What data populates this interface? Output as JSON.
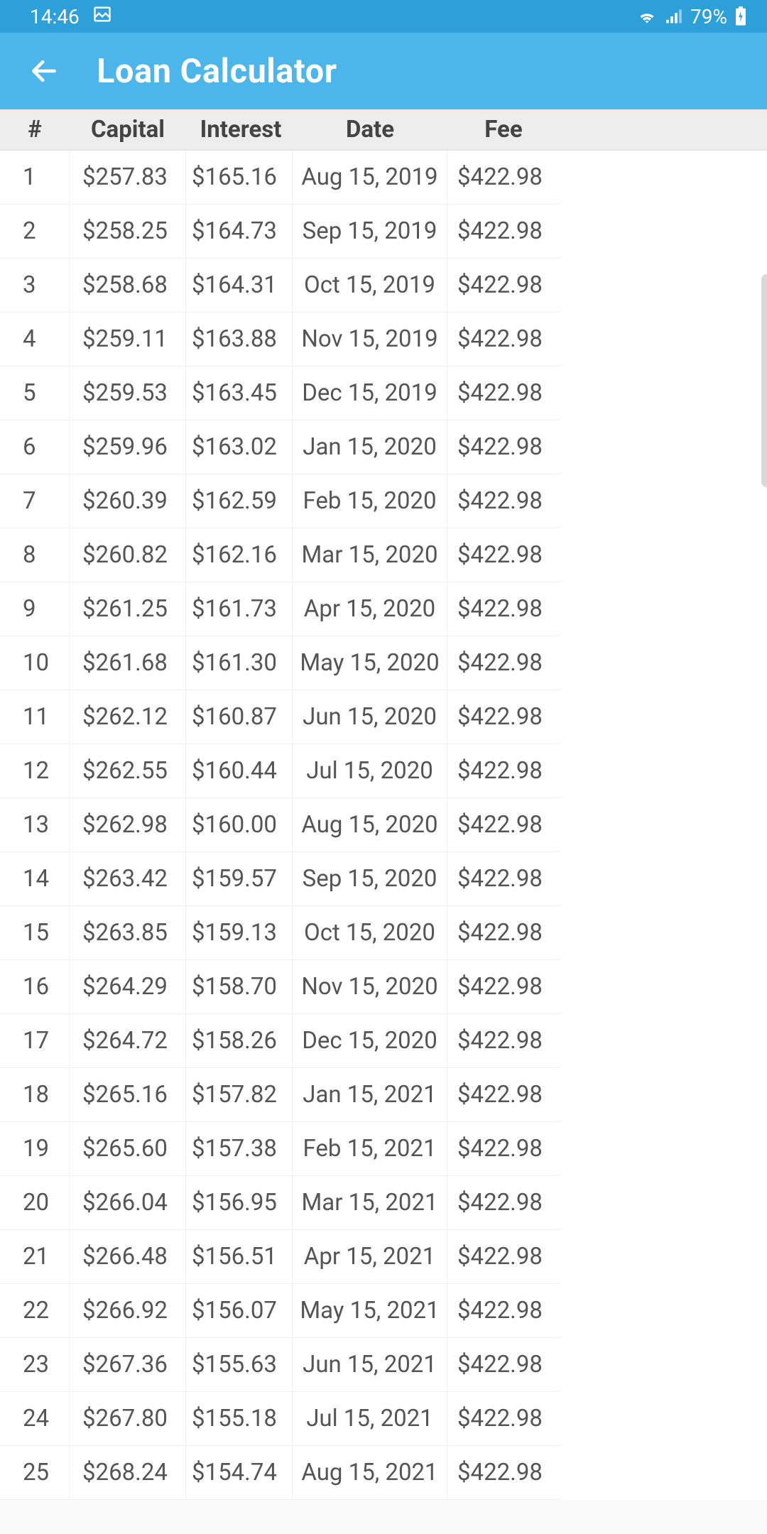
{
  "status": {
    "time": "14:46",
    "battery": "79%"
  },
  "appbar": {
    "title": "Loan Calculator"
  },
  "table": {
    "headers": {
      "num": "#",
      "capital": "Capital",
      "interest": "Interest",
      "date": "Date",
      "fee": "Fee"
    },
    "rows": [
      {
        "n": "1",
        "capital": "$257.83",
        "interest": "$165.16",
        "date": "Aug 15, 2019",
        "fee": "$422.98"
      },
      {
        "n": "2",
        "capital": "$258.25",
        "interest": "$164.73",
        "date": "Sep 15, 2019",
        "fee": "$422.98"
      },
      {
        "n": "3",
        "capital": "$258.68",
        "interest": "$164.31",
        "date": "Oct 15, 2019",
        "fee": "$422.98"
      },
      {
        "n": "4",
        "capital": "$259.11",
        "interest": "$163.88",
        "date": "Nov 15, 2019",
        "fee": "$422.98"
      },
      {
        "n": "5",
        "capital": "$259.53",
        "interest": "$163.45",
        "date": "Dec 15, 2019",
        "fee": "$422.98"
      },
      {
        "n": "6",
        "capital": "$259.96",
        "interest": "$163.02",
        "date": "Jan 15, 2020",
        "fee": "$422.98"
      },
      {
        "n": "7",
        "capital": "$260.39",
        "interest": "$162.59",
        "date": "Feb 15, 2020",
        "fee": "$422.98"
      },
      {
        "n": "8",
        "capital": "$260.82",
        "interest": "$162.16",
        "date": "Mar 15, 2020",
        "fee": "$422.98"
      },
      {
        "n": "9",
        "capital": "$261.25",
        "interest": "$161.73",
        "date": "Apr 15, 2020",
        "fee": "$422.98"
      },
      {
        "n": "10",
        "capital": "$261.68",
        "interest": "$161.30",
        "date": "May 15, 2020",
        "fee": "$422.98"
      },
      {
        "n": "11",
        "capital": "$262.12",
        "interest": "$160.87",
        "date": "Jun 15, 2020",
        "fee": "$422.98"
      },
      {
        "n": "12",
        "capital": "$262.55",
        "interest": "$160.44",
        "date": "Jul 15, 2020",
        "fee": "$422.98"
      },
      {
        "n": "13",
        "capital": "$262.98",
        "interest": "$160.00",
        "date": "Aug 15, 2020",
        "fee": "$422.98"
      },
      {
        "n": "14",
        "capital": "$263.42",
        "interest": "$159.57",
        "date": "Sep 15, 2020",
        "fee": "$422.98"
      },
      {
        "n": "15",
        "capital": "$263.85",
        "interest": "$159.13",
        "date": "Oct 15, 2020",
        "fee": "$422.98"
      },
      {
        "n": "16",
        "capital": "$264.29",
        "interest": "$158.70",
        "date": "Nov 15, 2020",
        "fee": "$422.98"
      },
      {
        "n": "17",
        "capital": "$264.72",
        "interest": "$158.26",
        "date": "Dec 15, 2020",
        "fee": "$422.98"
      },
      {
        "n": "18",
        "capital": "$265.16",
        "interest": "$157.82",
        "date": "Jan 15, 2021",
        "fee": "$422.98"
      },
      {
        "n": "19",
        "capital": "$265.60",
        "interest": "$157.38",
        "date": "Feb 15, 2021",
        "fee": "$422.98"
      },
      {
        "n": "20",
        "capital": "$266.04",
        "interest": "$156.95",
        "date": "Mar 15, 2021",
        "fee": "$422.98"
      },
      {
        "n": "21",
        "capital": "$266.48",
        "interest": "$156.51",
        "date": "Apr 15, 2021",
        "fee": "$422.98"
      },
      {
        "n": "22",
        "capital": "$266.92",
        "interest": "$156.07",
        "date": "May 15, 2021",
        "fee": "$422.98"
      },
      {
        "n": "23",
        "capital": "$267.36",
        "interest": "$155.63",
        "date": "Jun 15, 2021",
        "fee": "$422.98"
      },
      {
        "n": "24",
        "capital": "$267.80",
        "interest": "$155.18",
        "date": "Jul 15, 2021",
        "fee": "$422.98"
      },
      {
        "n": "25",
        "capital": "$268.24",
        "interest": "$154.74",
        "date": "Aug 15, 2021",
        "fee": "$422.98"
      }
    ]
  }
}
